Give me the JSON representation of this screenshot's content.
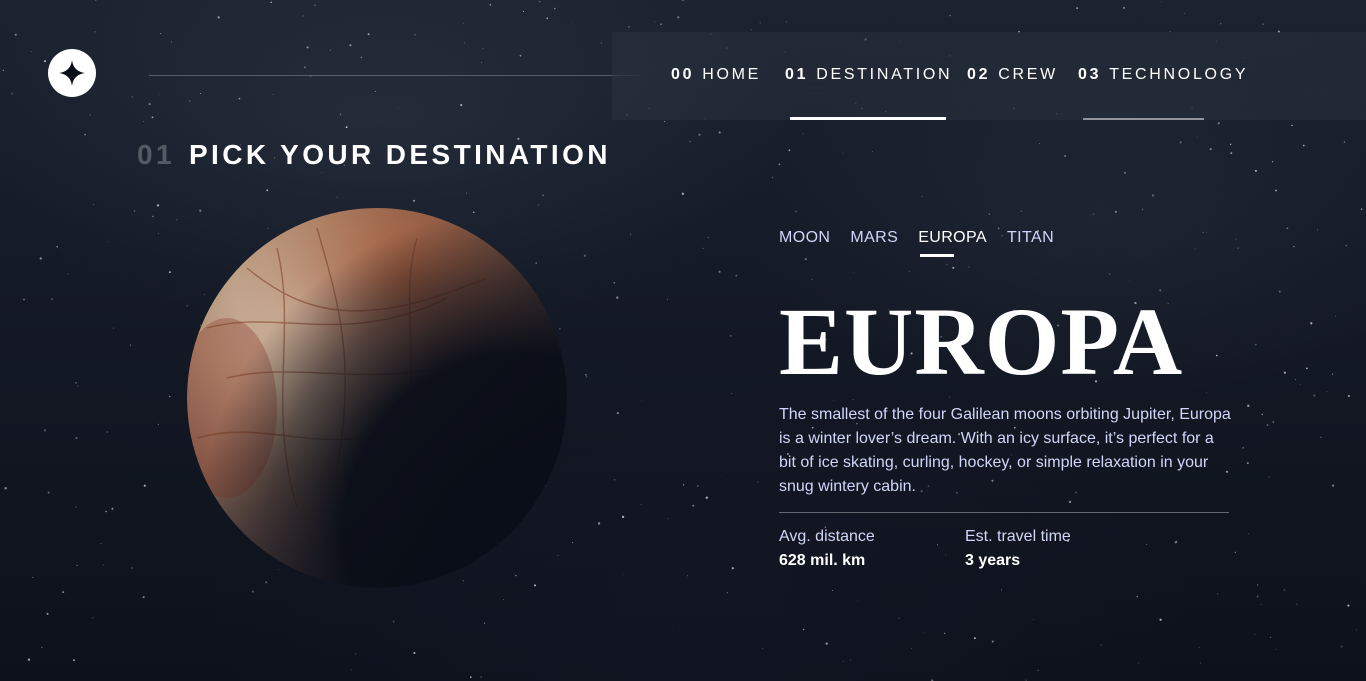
{
  "header": {
    "logo_name": "star-logo",
    "nav": [
      {
        "num": "00",
        "label": "HOME"
      },
      {
        "num": "01",
        "label": "DESTINATION"
      },
      {
        "num": "02",
        "label": "CREW"
      },
      {
        "num": "03",
        "label": "TECHNOLOGY"
      }
    ]
  },
  "page": {
    "heading_num": "01",
    "heading_text": "PICK YOUR DESTINATION"
  },
  "destination": {
    "tabs": [
      "MOON",
      "MARS",
      "EUROPA",
      "TITAN"
    ],
    "active_tab": "EUROPA",
    "name": "EUROPA",
    "description": "The smallest of the four Galilean moons orbiting Jupiter, Europa is a winter lover’s dream. With an icy surface, it’s perfect for a bit of ice skating, curling, hockey, or simple relaxation in your snug wintery cabin.",
    "stats": [
      {
        "label": "Avg. distance",
        "value": "628 mil. km"
      },
      {
        "label": "Est. travel time",
        "value": "3 years"
      }
    ]
  },
  "colors": {
    "accent": "#ffffff",
    "muted_text": "#d0d6f9",
    "background": "#0d111b"
  }
}
